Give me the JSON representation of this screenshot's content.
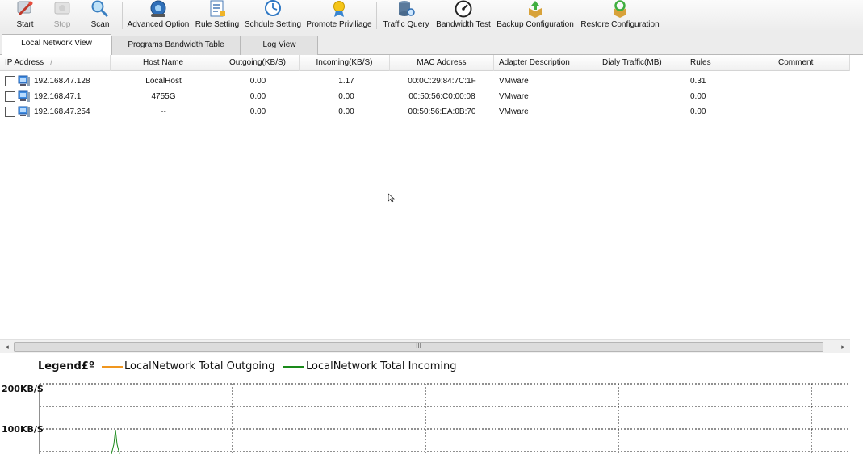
{
  "toolbar": {
    "buttons": [
      {
        "label": "Start",
        "icon": "start-icon",
        "enabled": true
      },
      {
        "label": "Stop",
        "icon": "stop-icon",
        "enabled": false
      },
      {
        "label": "Scan",
        "icon": "scan-icon",
        "enabled": true
      },
      {
        "label": "Advanced Option",
        "icon": "advanced-option-icon",
        "enabled": true
      },
      {
        "label": "Rule Setting",
        "icon": "rule-setting-icon",
        "enabled": true
      },
      {
        "label": "Schdule Setting",
        "icon": "schedule-setting-icon",
        "enabled": true
      },
      {
        "label": "Promote Priviliage",
        "icon": "promote-privilege-icon",
        "enabled": true
      },
      {
        "label": "Traffic Query",
        "icon": "traffic-query-icon",
        "enabled": true
      },
      {
        "label": "Bandwidth Test",
        "icon": "bandwidth-test-icon",
        "enabled": true
      },
      {
        "label": "Backup Configuration",
        "icon": "backup-configuration-icon",
        "enabled": true
      },
      {
        "label": "Restore Configuration",
        "icon": "restore-configuration-icon",
        "enabled": true
      }
    ]
  },
  "tabs": [
    {
      "label": "Local Network View",
      "active": true
    },
    {
      "label": "Programs Bandwidth Table",
      "active": false
    },
    {
      "label": "Log View",
      "active": false
    }
  ],
  "table": {
    "sort_indicator": "/",
    "columns": [
      "IP Address",
      "Host Name",
      "Outgoing(KB/S)",
      "Incoming(KB/S)",
      "MAC Address",
      "Adapter Description",
      "Dialy Traffic(MB)",
      "Rules",
      "Comment"
    ],
    "rows": [
      {
        "ip": "192.168.47.128",
        "host": "LocalHost",
        "out": "0.00",
        "in": "1.17",
        "mac": "00:0C:29:84:7C:1F",
        "adapter": "VMware",
        "daily": "",
        "rules": "0.31",
        "comment": ""
      },
      {
        "ip": "192.168.47.1",
        "host": "4755G",
        "out": "0.00",
        "in": "0.00",
        "mac": "00:50:56:C0:00:08",
        "adapter": "VMware",
        "daily": "",
        "rules": "0.00",
        "comment": ""
      },
      {
        "ip": "192.168.47.254",
        "host": "--",
        "out": "0.00",
        "in": "0.00",
        "mac": "00:50:56:EA:0B:70",
        "adapter": "VMware",
        "daily": "",
        "rules": "0.00",
        "comment": ""
      }
    ]
  },
  "scrollbar": {
    "thumb_grip": "III"
  },
  "legend": {
    "title": "Legend£º",
    "outgoing_label": "LocalNetwork Total Outgoing",
    "incoming_label": "LocalNetwork Total Incoming",
    "outgoing_color": "#f0961e",
    "incoming_color": "#1a8a1a"
  },
  "chart": {
    "y_labels": [
      "200KB/S",
      "100KB/S"
    ]
  }
}
